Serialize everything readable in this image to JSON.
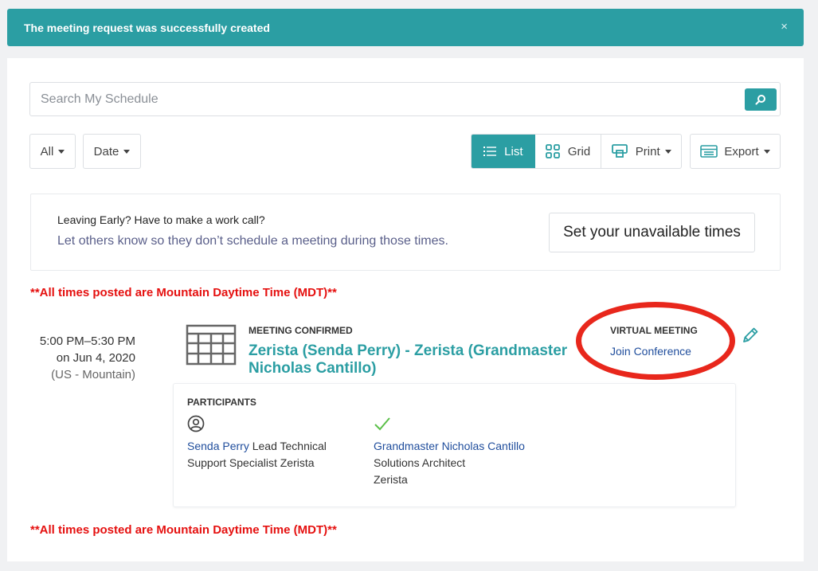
{
  "alert": {
    "message": "The meeting request was successfully created",
    "close_icon": "×"
  },
  "search": {
    "placeholder": "Search My Schedule",
    "value": "",
    "button_icon": "search-icon"
  },
  "filters": {
    "all_label": "All",
    "date_label": "Date"
  },
  "views": {
    "list_label": "List",
    "grid_label": "Grid",
    "print_label": "Print",
    "export_label": "Export"
  },
  "callout": {
    "heading": "Leaving Early? Have to make a work call?",
    "subtext": "Let others know so they don’t schedule a meeting during those times.",
    "button_label": "Set your unavailable times"
  },
  "timezone_notice": "**All times posted are Mountain Daytime Time (MDT)**",
  "meeting": {
    "time_range": "5:00 PM–5:30 PM",
    "date": "on Jun 4, 2020",
    "zone": "(US - Mountain)",
    "status": "MEETING CONFIRMED",
    "title": "Zerista (Senda Perry) - Zerista (Grandmaster Nicholas Cantillo)",
    "virtual_label": "VIRTUAL MEETING",
    "join_link": "Join Conference",
    "participants_label": "PARTICIPANTS",
    "participants": [
      {
        "name": "Senda Perry",
        "detail": " Lead Technical",
        "detail2": "Support Specialist Zerista",
        "icon": "user-circle-icon"
      },
      {
        "name": "Grandmaster Nicholas Cantillo",
        "detail": "Solutions Architect",
        "detail2": "Zerista",
        "icon": "check-icon"
      }
    ]
  },
  "colors": {
    "accent": "#2b9ea3",
    "warning": "#e5100f",
    "link": "#1f4d9c",
    "highlight": "#e8271c"
  }
}
